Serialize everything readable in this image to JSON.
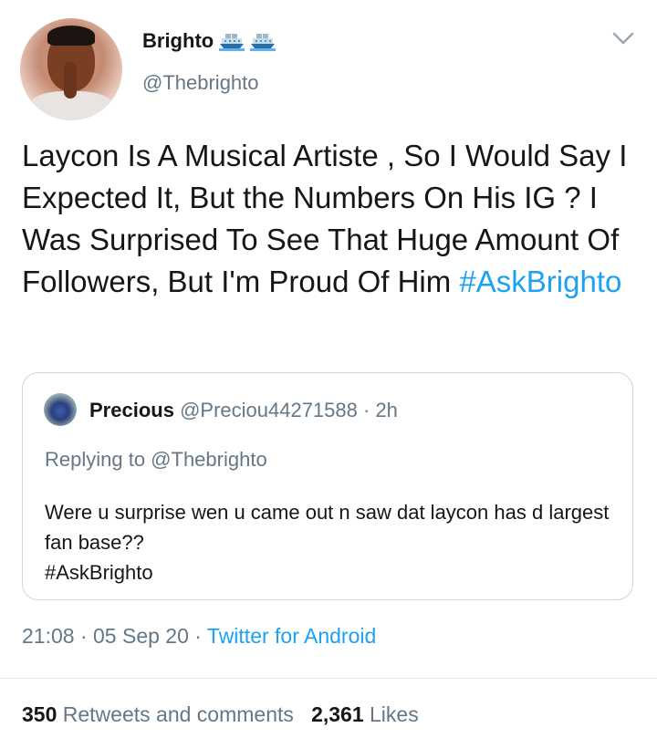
{
  "author": {
    "display_name": "Brighto",
    "name_emojis": [
      "ship-emoji",
      "ship-emoji"
    ],
    "username": "@Thebrighto"
  },
  "tweet": {
    "text": "Laycon Is A Musical Artiste , So I Would Say I Expected It, But the Numbers On His IG ? I Was Surprised To See That Huge Amount Of Followers, But I'm Proud Of Him ",
    "hashtag": "#AskBrighto"
  },
  "quoted_tweet": {
    "name": "Precious",
    "handle": "@Preciou44271588",
    "separator": " · ",
    "time": "2h",
    "replying_to": "Replying to @Thebrighto",
    "text_line1": "Were u surprise wen u came out n saw dat laycon has d largest fan base??",
    "text_line2": "#AskBrighto"
  },
  "meta": {
    "time": "21:08",
    "separator": " · ",
    "date": "05 Sep 20",
    "source": "Twitter for Android"
  },
  "stats": {
    "retweets_count": "350",
    "retweets_label": "Retweets and comments",
    "likes_count": "2,361",
    "likes_label": "Likes"
  },
  "colors": {
    "accent": "#1da1f2",
    "secondary_text": "#657786",
    "primary_text": "#14171a",
    "border": "#ccd6dd"
  },
  "icons": {
    "menu": "chevron-down-icon"
  }
}
